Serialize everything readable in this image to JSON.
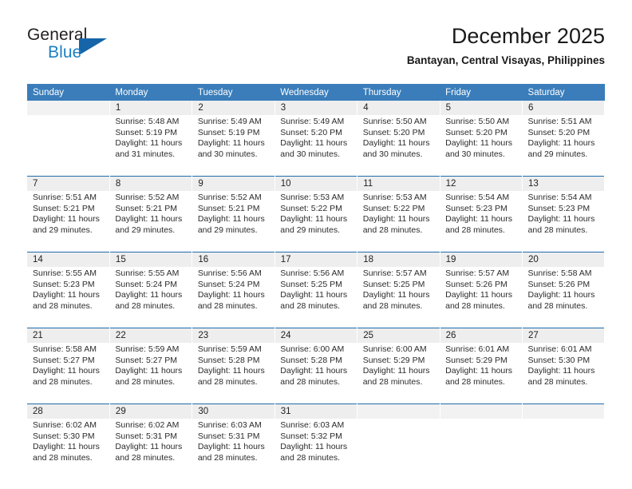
{
  "brand": {
    "name_part1": "General",
    "name_part2": "Blue",
    "accent_color": "#1c7fc3",
    "triangle_color": "#1565a8"
  },
  "header": {
    "title": "December 2025",
    "subtitle": "Bantayan, Central Visayas, Philippines"
  },
  "theme": {
    "header_band": "#3a7dba",
    "daynum_band": "#eeeeee",
    "week_divider": "#1f6cab"
  },
  "weekday_headers": [
    "Sunday",
    "Monday",
    "Tuesday",
    "Wednesday",
    "Thursday",
    "Friday",
    "Saturday"
  ],
  "labels": {
    "sunrise_prefix": "Sunrise:",
    "sunset_prefix": "Sunset:",
    "daylight_prefix": "Daylight:"
  },
  "weeks": [
    {
      "days": [
        {
          "num": "",
          "l1": "",
          "l2": "",
          "l3": "",
          "l4": ""
        },
        {
          "num": "1",
          "l1": "Sunrise: 5:48 AM",
          "l2": "Sunset: 5:19 PM",
          "l3": "Daylight: 11 hours",
          "l4": "and 31 minutes."
        },
        {
          "num": "2",
          "l1": "Sunrise: 5:49 AM",
          "l2": "Sunset: 5:19 PM",
          "l3": "Daylight: 11 hours",
          "l4": "and 30 minutes."
        },
        {
          "num": "3",
          "l1": "Sunrise: 5:49 AM",
          "l2": "Sunset: 5:20 PM",
          "l3": "Daylight: 11 hours",
          "l4": "and 30 minutes."
        },
        {
          "num": "4",
          "l1": "Sunrise: 5:50 AM",
          "l2": "Sunset: 5:20 PM",
          "l3": "Daylight: 11 hours",
          "l4": "and 30 minutes."
        },
        {
          "num": "5",
          "l1": "Sunrise: 5:50 AM",
          "l2": "Sunset: 5:20 PM",
          "l3": "Daylight: 11 hours",
          "l4": "and 30 minutes."
        },
        {
          "num": "6",
          "l1": "Sunrise: 5:51 AM",
          "l2": "Sunset: 5:20 PM",
          "l3": "Daylight: 11 hours",
          "l4": "and 29 minutes."
        }
      ]
    },
    {
      "days": [
        {
          "num": "7",
          "l1": "Sunrise: 5:51 AM",
          "l2": "Sunset: 5:21 PM",
          "l3": "Daylight: 11 hours",
          "l4": "and 29 minutes."
        },
        {
          "num": "8",
          "l1": "Sunrise: 5:52 AM",
          "l2": "Sunset: 5:21 PM",
          "l3": "Daylight: 11 hours",
          "l4": "and 29 minutes."
        },
        {
          "num": "9",
          "l1": "Sunrise: 5:52 AM",
          "l2": "Sunset: 5:21 PM",
          "l3": "Daylight: 11 hours",
          "l4": "and 29 minutes."
        },
        {
          "num": "10",
          "l1": "Sunrise: 5:53 AM",
          "l2": "Sunset: 5:22 PM",
          "l3": "Daylight: 11 hours",
          "l4": "and 29 minutes."
        },
        {
          "num": "11",
          "l1": "Sunrise: 5:53 AM",
          "l2": "Sunset: 5:22 PM",
          "l3": "Daylight: 11 hours",
          "l4": "and 28 minutes."
        },
        {
          "num": "12",
          "l1": "Sunrise: 5:54 AM",
          "l2": "Sunset: 5:23 PM",
          "l3": "Daylight: 11 hours",
          "l4": "and 28 minutes."
        },
        {
          "num": "13",
          "l1": "Sunrise: 5:54 AM",
          "l2": "Sunset: 5:23 PM",
          "l3": "Daylight: 11 hours",
          "l4": "and 28 minutes."
        }
      ]
    },
    {
      "days": [
        {
          "num": "14",
          "l1": "Sunrise: 5:55 AM",
          "l2": "Sunset: 5:23 PM",
          "l3": "Daylight: 11 hours",
          "l4": "and 28 minutes."
        },
        {
          "num": "15",
          "l1": "Sunrise: 5:55 AM",
          "l2": "Sunset: 5:24 PM",
          "l3": "Daylight: 11 hours",
          "l4": "and 28 minutes."
        },
        {
          "num": "16",
          "l1": "Sunrise: 5:56 AM",
          "l2": "Sunset: 5:24 PM",
          "l3": "Daylight: 11 hours",
          "l4": "and 28 minutes."
        },
        {
          "num": "17",
          "l1": "Sunrise: 5:56 AM",
          "l2": "Sunset: 5:25 PM",
          "l3": "Daylight: 11 hours",
          "l4": "and 28 minutes."
        },
        {
          "num": "18",
          "l1": "Sunrise: 5:57 AM",
          "l2": "Sunset: 5:25 PM",
          "l3": "Daylight: 11 hours",
          "l4": "and 28 minutes."
        },
        {
          "num": "19",
          "l1": "Sunrise: 5:57 AM",
          "l2": "Sunset: 5:26 PM",
          "l3": "Daylight: 11 hours",
          "l4": "and 28 minutes."
        },
        {
          "num": "20",
          "l1": "Sunrise: 5:58 AM",
          "l2": "Sunset: 5:26 PM",
          "l3": "Daylight: 11 hours",
          "l4": "and 28 minutes."
        }
      ]
    },
    {
      "days": [
        {
          "num": "21",
          "l1": "Sunrise: 5:58 AM",
          "l2": "Sunset: 5:27 PM",
          "l3": "Daylight: 11 hours",
          "l4": "and 28 minutes."
        },
        {
          "num": "22",
          "l1": "Sunrise: 5:59 AM",
          "l2": "Sunset: 5:27 PM",
          "l3": "Daylight: 11 hours",
          "l4": "and 28 minutes."
        },
        {
          "num": "23",
          "l1": "Sunrise: 5:59 AM",
          "l2": "Sunset: 5:28 PM",
          "l3": "Daylight: 11 hours",
          "l4": "and 28 minutes."
        },
        {
          "num": "24",
          "l1": "Sunrise: 6:00 AM",
          "l2": "Sunset: 5:28 PM",
          "l3": "Daylight: 11 hours",
          "l4": "and 28 minutes."
        },
        {
          "num": "25",
          "l1": "Sunrise: 6:00 AM",
          "l2": "Sunset: 5:29 PM",
          "l3": "Daylight: 11 hours",
          "l4": "and 28 minutes."
        },
        {
          "num": "26",
          "l1": "Sunrise: 6:01 AM",
          "l2": "Sunset: 5:29 PM",
          "l3": "Daylight: 11 hours",
          "l4": "and 28 minutes."
        },
        {
          "num": "27",
          "l1": "Sunrise: 6:01 AM",
          "l2": "Sunset: 5:30 PM",
          "l3": "Daylight: 11 hours",
          "l4": "and 28 minutes."
        }
      ]
    },
    {
      "days": [
        {
          "num": "28",
          "l1": "Sunrise: 6:02 AM",
          "l2": "Sunset: 5:30 PM",
          "l3": "Daylight: 11 hours",
          "l4": "and 28 minutes."
        },
        {
          "num": "29",
          "l1": "Sunrise: 6:02 AM",
          "l2": "Sunset: 5:31 PM",
          "l3": "Daylight: 11 hours",
          "l4": "and 28 minutes."
        },
        {
          "num": "30",
          "l1": "Sunrise: 6:03 AM",
          "l2": "Sunset: 5:31 PM",
          "l3": "Daylight: 11 hours",
          "l4": "and 28 minutes."
        },
        {
          "num": "31",
          "l1": "Sunrise: 6:03 AM",
          "l2": "Sunset: 5:32 PM",
          "l3": "Daylight: 11 hours",
          "l4": "and 28 minutes."
        },
        {
          "num": "",
          "l1": "",
          "l2": "",
          "l3": "",
          "l4": ""
        },
        {
          "num": "",
          "l1": "",
          "l2": "",
          "l3": "",
          "l4": ""
        },
        {
          "num": "",
          "l1": "",
          "l2": "",
          "l3": "",
          "l4": ""
        }
      ]
    }
  ]
}
